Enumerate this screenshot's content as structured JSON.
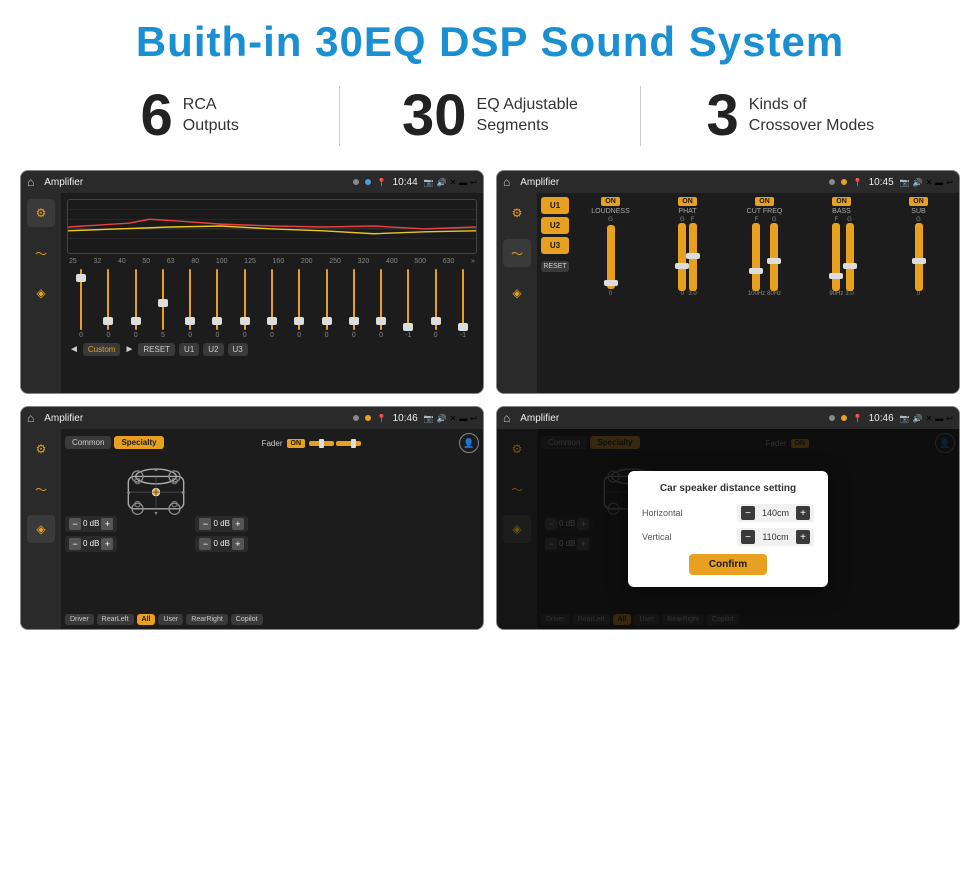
{
  "header": {
    "title": "Buith-in 30EQ DSP Sound System"
  },
  "stats": [
    {
      "number": "6",
      "label_line1": "RCA",
      "label_line2": "Outputs"
    },
    {
      "number": "30",
      "label_line1": "EQ Adjustable",
      "label_line2": "Segments"
    },
    {
      "number": "3",
      "label_line1": "Kinds of",
      "label_line2": "Crossover Modes"
    }
  ],
  "screens": {
    "eq": {
      "title": "Amplifier",
      "time": "10:44",
      "freqs": [
        "25",
        "32",
        "40",
        "50",
        "63",
        "80",
        "100",
        "125",
        "160",
        "200",
        "250",
        "320",
        "400",
        "500",
        "630"
      ],
      "values": [
        "0",
        "0",
        "0",
        "5",
        "0",
        "0",
        "0",
        "0",
        "0",
        "0",
        "0",
        "0",
        "-1",
        "0",
        "-1"
      ],
      "preset": "Custom",
      "buttons": [
        "◄",
        "Custom",
        "►",
        "RESET",
        "U1",
        "U2",
        "U3"
      ]
    },
    "crossover": {
      "title": "Amplifier",
      "time": "10:45",
      "presets": [
        "U1",
        "U2",
        "U3"
      ],
      "reset": "RESET",
      "channels": [
        {
          "name": "LOUDNESS",
          "on": true
        },
        {
          "name": "PHAT",
          "on": true
        },
        {
          "name": "CUT FREQ",
          "on": true
        },
        {
          "name": "BASS",
          "on": true
        },
        {
          "name": "SUB",
          "on": true
        }
      ]
    },
    "fader": {
      "title": "Amplifier",
      "time": "10:46",
      "tabs": [
        "Common",
        "Specialty"
      ],
      "fader_label": "Fader",
      "on": "ON",
      "db_values": [
        "0 dB",
        "0 dB",
        "0 dB",
        "0 dB"
      ],
      "buttons": [
        "Driver",
        "RearLeft",
        "All",
        "User",
        "RearRight",
        "Copilot"
      ]
    },
    "fader_dialog": {
      "title": "Amplifier",
      "time": "10:46",
      "tabs": [
        "Common",
        "Specialty"
      ],
      "dialog": {
        "title": "Car speaker distance setting",
        "horizontal_label": "Horizontal",
        "horizontal_value": "140cm",
        "vertical_label": "Vertical",
        "vertical_value": "110cm",
        "confirm": "Confirm"
      },
      "db_values": [
        "0 dB",
        "0 dB"
      ],
      "buttons": [
        "Driver",
        "RearLeft",
        "All",
        "User",
        "RearRight",
        "Copilot"
      ]
    }
  }
}
